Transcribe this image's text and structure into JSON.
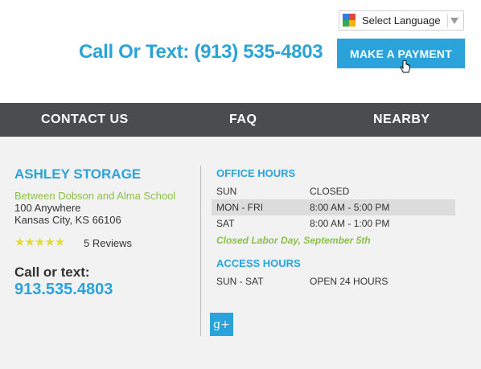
{
  "header": {
    "language_selector": {
      "label": "Select Language"
    },
    "call_text": "Call Or Text: (913) 535-4803",
    "payment_button": "MAKE A PAYMENT"
  },
  "nav": {
    "items": [
      {
        "label": "CONTACT US"
      },
      {
        "label": "FAQ"
      },
      {
        "label": "NEARBY"
      }
    ]
  },
  "location": {
    "name": "ASHLEY STORAGE",
    "cross_streets": "Between Dobson and Alma School",
    "address_line1": "100 Anywhere",
    "address_line2": "Kansas City, KS 66106",
    "rating_stars": "★★★★★",
    "rating_value": 5,
    "reviews": "5 Reviews",
    "call_label": "Call or text:",
    "phone": "913.535.4803"
  },
  "office_hours": {
    "heading": "OFFICE HOURS",
    "rows": [
      {
        "day": "SUN",
        "time": "CLOSED"
      },
      {
        "day": "MON - FRI",
        "time": "8:00 AM - 5:00 PM"
      },
      {
        "day": "SAT",
        "time": "8:00 AM - 1:00 PM"
      }
    ],
    "note": "Closed Labor Day, September 5th"
  },
  "access_hours": {
    "heading": "ACCESS HOURS",
    "rows": [
      {
        "day": "SUN - SAT",
        "time": "OPEN 24 HOURS"
      }
    ]
  },
  "social": {
    "icon": "google-plus-icon",
    "glyph": "g+"
  },
  "colors": {
    "brand_blue": "#2aa3db",
    "green": "#8cc04b",
    "nav_bg": "#4b4c4e",
    "panel_bg": "#f2f2f2",
    "star": "#e2dc2e"
  }
}
